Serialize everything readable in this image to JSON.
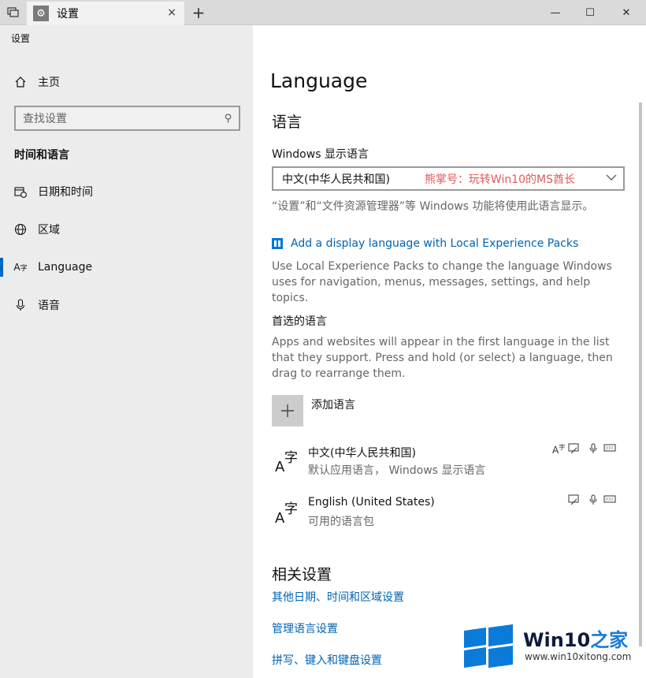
{
  "window": {
    "tab_title": "设置",
    "tab_icon": "gear-icon",
    "close_tab": "×",
    "new_tab": "+",
    "minimize": "—",
    "maximize": "☐",
    "close": "✕"
  },
  "sidebar": {
    "app_title": "设置",
    "home_label": "主页",
    "search_placeholder": "查找设置",
    "section_title": "时间和语言",
    "items": [
      {
        "label": "日期和时间",
        "icon": "calendar-clock-icon"
      },
      {
        "label": "区域",
        "icon": "globe-icon"
      },
      {
        "label": "Language",
        "icon": "language-icon",
        "active": true
      },
      {
        "label": "语音",
        "icon": "microphone-icon"
      }
    ]
  },
  "main": {
    "page_title": "Language",
    "section_language": "语言",
    "display_language_label": "Windows 显示语言",
    "display_language_value": "中文(中华人民共和国)",
    "watermark_text": "熊掌号：玩转Win10的MS酋长",
    "display_language_desc": "“设置”和“文件资源管理器”等 Windows 功能将使用此语言显示。",
    "add_display_language_link": "Add a display language with Local Experience Packs",
    "lep_desc": "Use Local Experience Packs to change the language Windows uses for navigation, menus, messages, settings, and help topics.",
    "preferred_title": "首选的语言",
    "preferred_desc": "Apps and websites will appear in the first language in the list that they support. Press and hold (or select) a language, then drag to rearrange them.",
    "add_language_label": "添加语言",
    "languages": [
      {
        "name": "中文(中华人民共和国)",
        "sub": "默认应用语言， Windows 显示语言"
      },
      {
        "name": "English (United States)",
        "sub": "可用的语言包"
      }
    ],
    "related_title": "相关设置",
    "related_links": [
      "其他日期、时间和区域设置",
      "管理语言设置",
      "拼写、键入和键盘设置"
    ]
  },
  "watermark": {
    "brand": "Win10",
    "brand_suffix": "之家",
    "url": "www.win10xitong.com",
    "color": "#0b7bd9"
  },
  "colors": {
    "accent": "#0067c0",
    "link": "#0063b1",
    "sidebar_bg": "#ececec"
  }
}
